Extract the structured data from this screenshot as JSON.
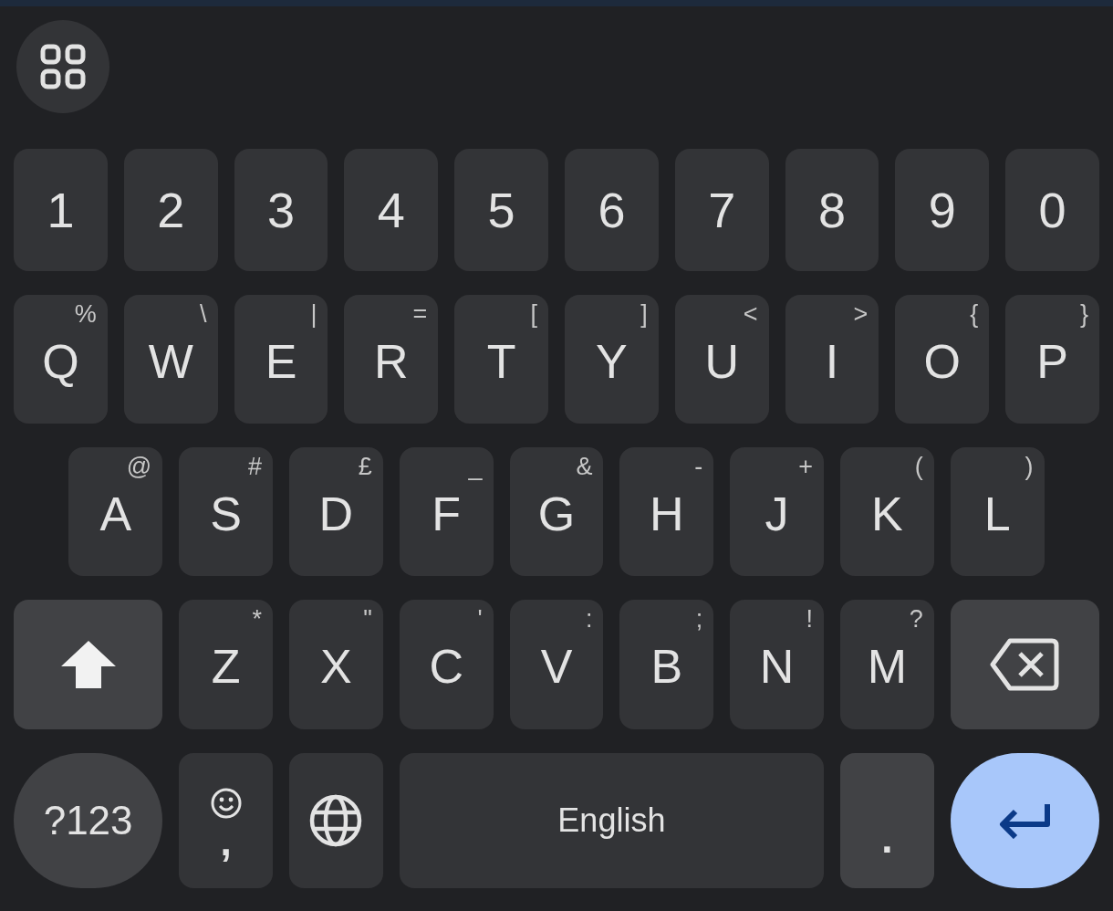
{
  "toolbar": {
    "kind": "apps"
  },
  "rows": [
    {
      "keys": [
        {
          "kind": "char",
          "label": "1"
        },
        {
          "kind": "char",
          "label": "2"
        },
        {
          "kind": "char",
          "label": "3"
        },
        {
          "kind": "char",
          "label": "4"
        },
        {
          "kind": "char",
          "label": "5"
        },
        {
          "kind": "char",
          "label": "6"
        },
        {
          "kind": "char",
          "label": "7"
        },
        {
          "kind": "char",
          "label": "8"
        },
        {
          "kind": "char",
          "label": "9"
        },
        {
          "kind": "char",
          "label": "0"
        }
      ]
    },
    {
      "keys": [
        {
          "kind": "char",
          "label": "Q",
          "hint": "%"
        },
        {
          "kind": "char",
          "label": "W",
          "hint": "\\"
        },
        {
          "kind": "char",
          "label": "E",
          "hint": "|"
        },
        {
          "kind": "char",
          "label": "R",
          "hint": "="
        },
        {
          "kind": "char",
          "label": "T",
          "hint": "["
        },
        {
          "kind": "char",
          "label": "Y",
          "hint": "]"
        },
        {
          "kind": "char",
          "label": "U",
          "hint": "<"
        },
        {
          "kind": "char",
          "label": "I",
          "hint": ">"
        },
        {
          "kind": "char",
          "label": "O",
          "hint": "{"
        },
        {
          "kind": "char",
          "label": "P",
          "hint": "}"
        }
      ]
    },
    {
      "keys": [
        {
          "kind": "char",
          "label": "A",
          "hint": "@"
        },
        {
          "kind": "char",
          "label": "S",
          "hint": "#"
        },
        {
          "kind": "char",
          "label": "D",
          "hint": "£"
        },
        {
          "kind": "char",
          "label": "F",
          "hint": "_"
        },
        {
          "kind": "char",
          "label": "G",
          "hint": "&"
        },
        {
          "kind": "char",
          "label": "H",
          "hint": "-"
        },
        {
          "kind": "char",
          "label": "J",
          "hint": "+"
        },
        {
          "kind": "char",
          "label": "K",
          "hint": "("
        },
        {
          "kind": "char",
          "label": "L",
          "hint": ")"
        }
      ]
    },
    {
      "keys": [
        {
          "kind": "shift"
        },
        {
          "kind": "char",
          "label": "Z",
          "hint": "*"
        },
        {
          "kind": "char",
          "label": "X",
          "hint": "\""
        },
        {
          "kind": "char",
          "label": "C",
          "hint": "'"
        },
        {
          "kind": "char",
          "label": "V",
          "hint": ":"
        },
        {
          "kind": "char",
          "label": "B",
          "hint": ";"
        },
        {
          "kind": "char",
          "label": "N",
          "hint": "!"
        },
        {
          "kind": "char",
          "label": "M",
          "hint": "?"
        },
        {
          "kind": "backspace"
        }
      ]
    },
    {
      "keys": [
        {
          "kind": "symbols",
          "label": "?123"
        },
        {
          "kind": "emoji",
          "label": ","
        },
        {
          "kind": "globe"
        },
        {
          "kind": "space",
          "label": "English"
        },
        {
          "kind": "period",
          "label": "."
        },
        {
          "kind": "enter"
        }
      ]
    }
  ]
}
